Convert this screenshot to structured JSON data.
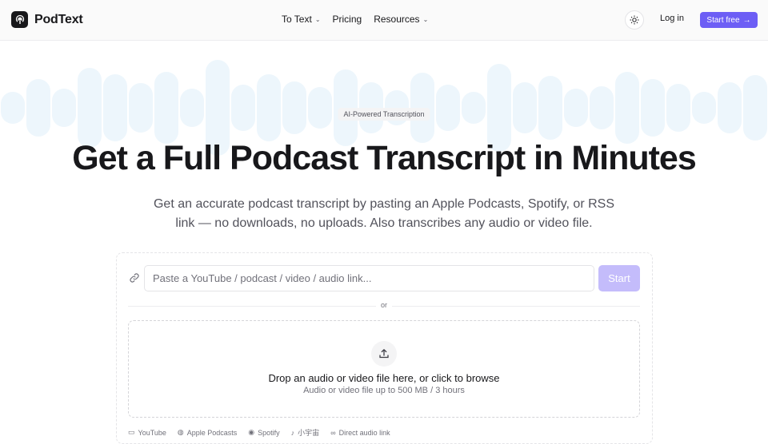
{
  "brand": {
    "name": "PodText"
  },
  "nav": [
    {
      "label": "To Text",
      "dropdown": true
    },
    {
      "label": "Pricing",
      "dropdown": false
    },
    {
      "label": "Resources",
      "dropdown": true
    }
  ],
  "header": {
    "login_label": "Log in",
    "cta_label": "Start free"
  },
  "hero": {
    "badge": "AI-Powered Transcription",
    "title": "Get a Full Podcast Transcript in Minutes",
    "subtitle": "Get an accurate podcast transcript by pasting an Apple Podcasts, Spotify, or RSS link — no downloads, no uploads. Also transcribes any audio or video file."
  },
  "input": {
    "placeholder": "Paste a YouTube / podcast / video / audio link...",
    "value": "",
    "start_label": "Start"
  },
  "divider": {
    "label": "or"
  },
  "dropzone": {
    "title": "Drop an audio or video file here, or click to browse",
    "subtitle": "Audio or video file up to 500 MB / 3 hours"
  },
  "sources": [
    "YouTube",
    "Apple Podcasts",
    "Spotify",
    "小宇宙",
    "Direct audio link"
  ],
  "colors": {
    "accent": "#6d5ef5",
    "accent_disabled": "#c4bcfb",
    "wave": "#edf6fc"
  }
}
